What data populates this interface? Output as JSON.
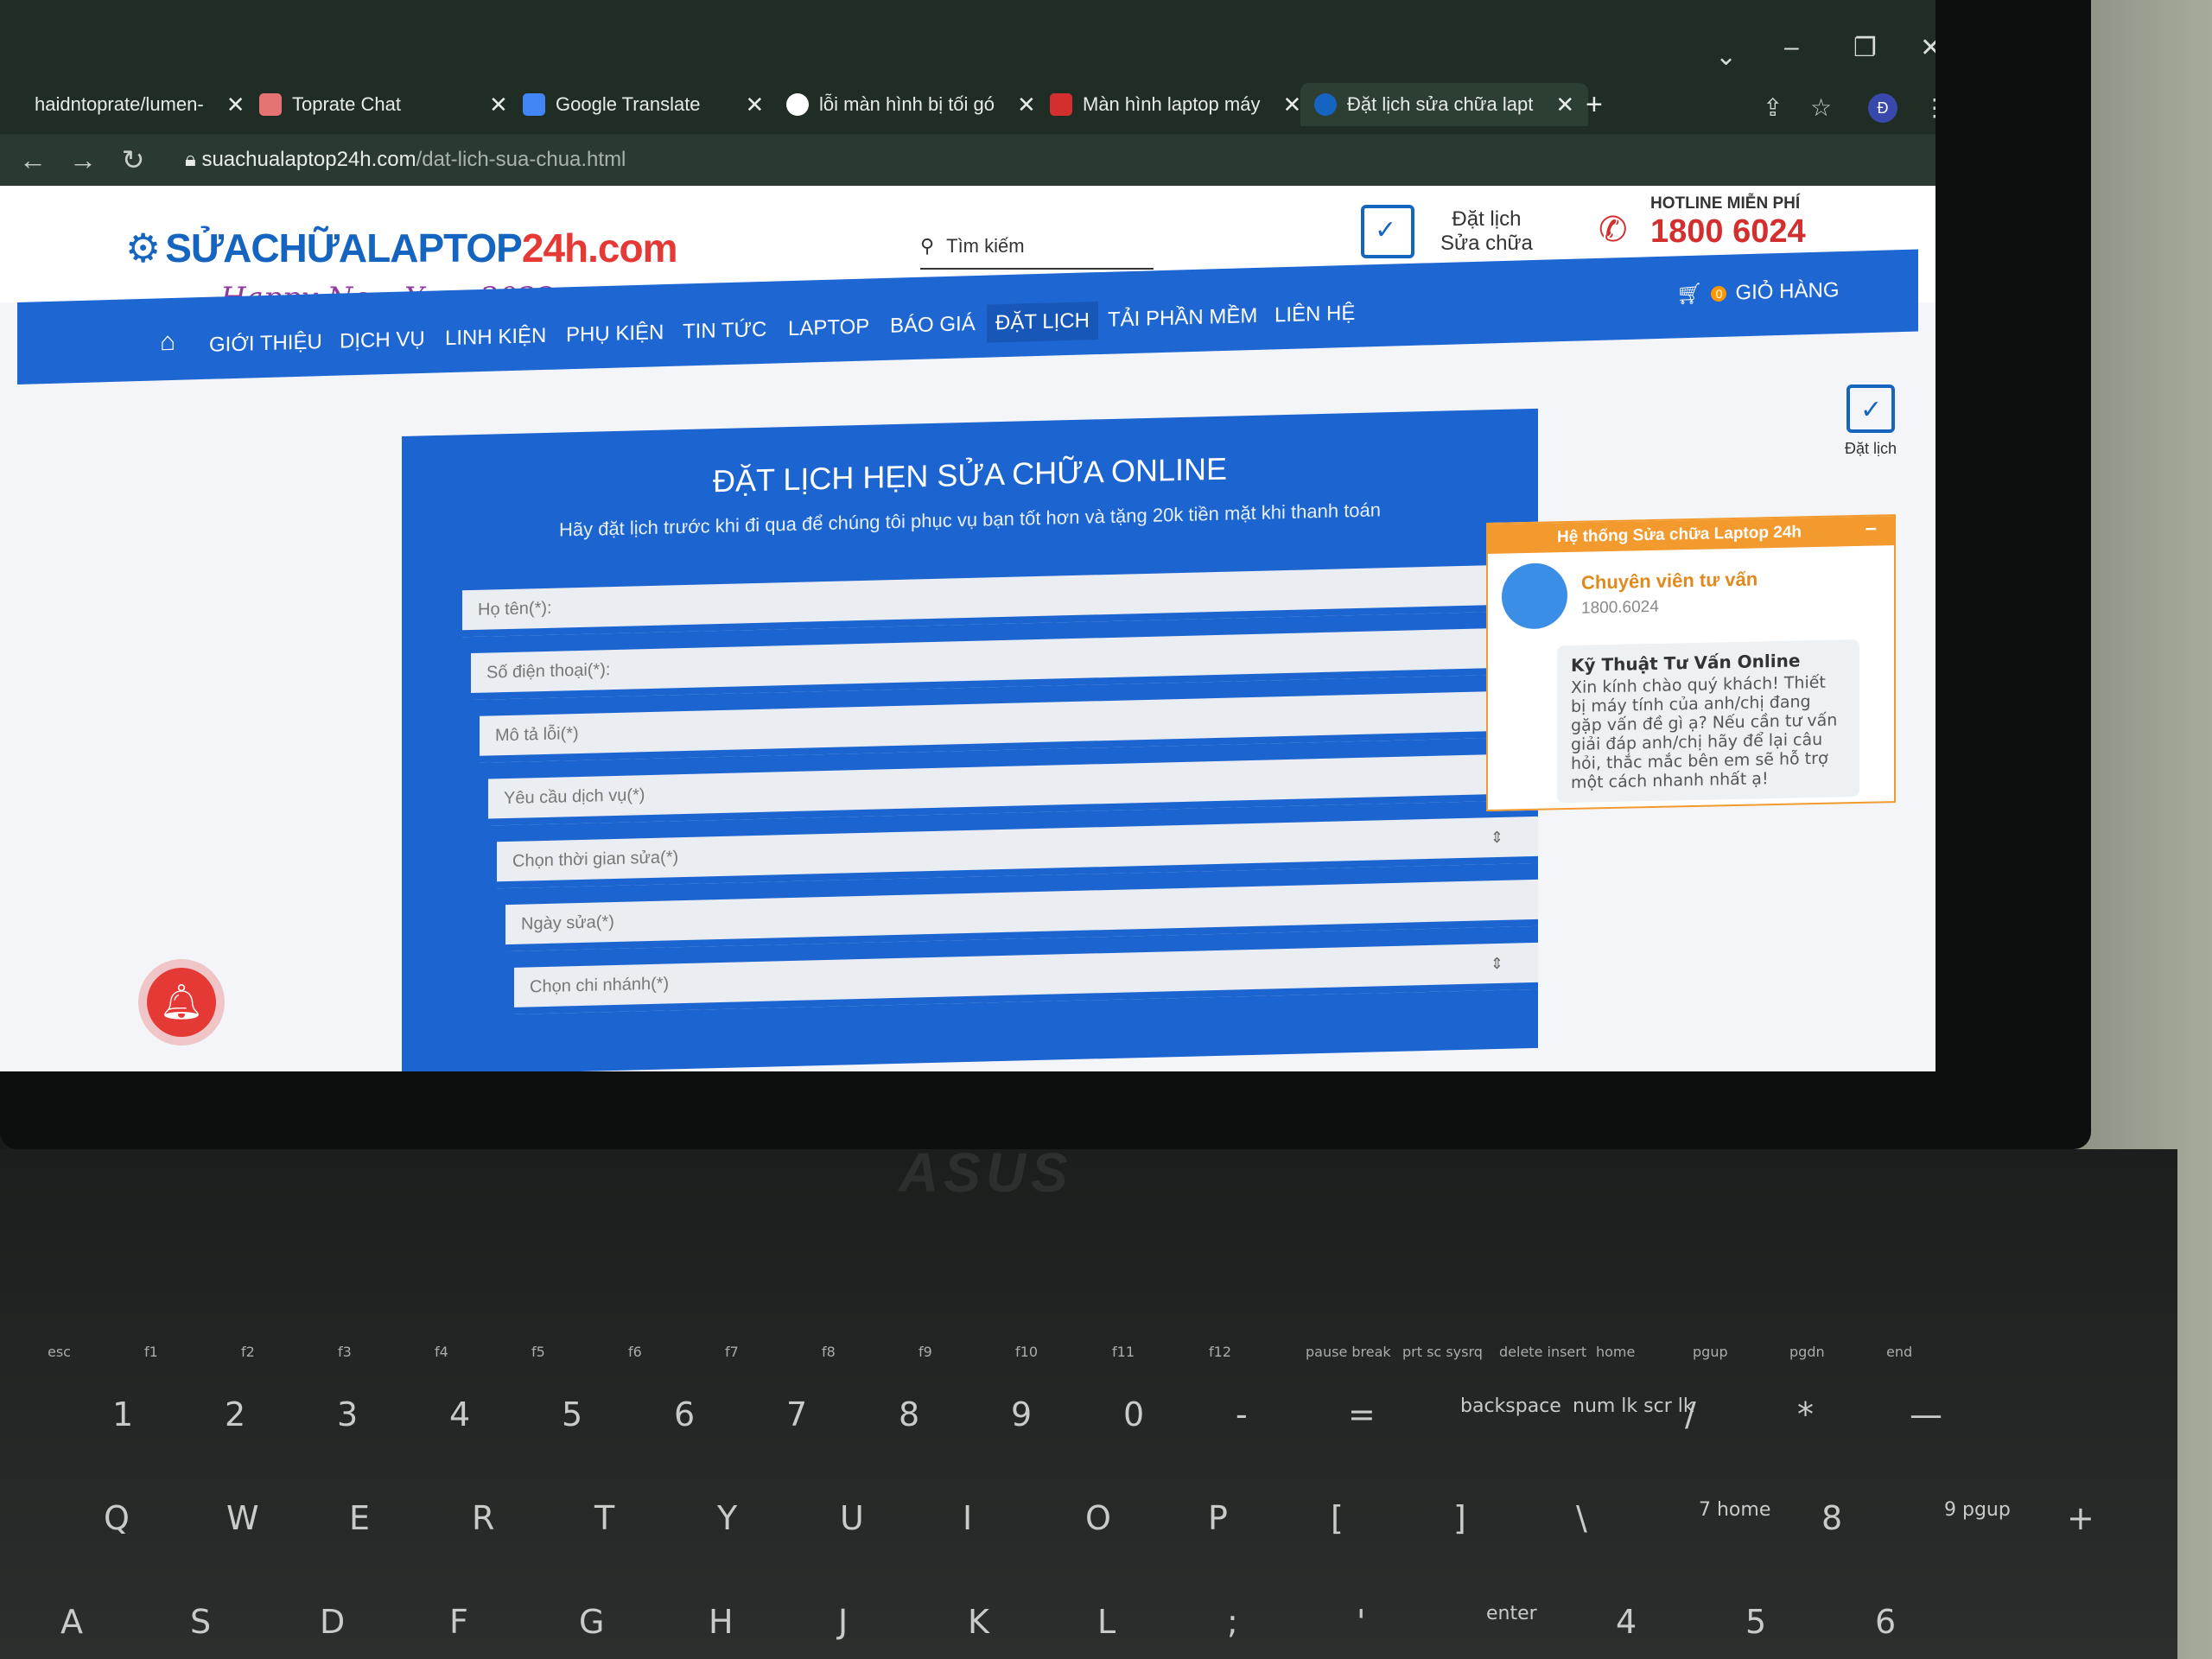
{
  "browser": {
    "tabs": [
      {
        "label": "haidntoprate/lumen-",
        "active": false
      },
      {
        "label": "Toprate Chat",
        "active": false
      },
      {
        "label": "Google Translate",
        "active": false
      },
      {
        "label": "lỗi màn hình bị tối gó",
        "active": false
      },
      {
        "label": "Màn hình laptop máy",
        "active": false
      },
      {
        "label": "Đặt lịch sửa chữa lapt",
        "active": true
      }
    ],
    "new_tab": "+",
    "url_host": "suachualaptop24h.com",
    "url_path": "/dat-lich-sua-chua.html",
    "profile_initial": "Đ"
  },
  "header": {
    "logo_text_main": "SỬACHỮALAPTOP",
    "logo_text_accent": "24h.com",
    "logo_tagline": "Happy New Year 2022",
    "search_placeholder": "Tìm kiếm",
    "booking_line1": "Đặt lịch",
    "booking_line2": "Sửa chữa",
    "hotline_label": "HOTLINE MIỄN PHÍ",
    "hotline_number": "1800 6024"
  },
  "nav": {
    "items": [
      "GIỚI THIỆU",
      "DỊCH VỤ",
      "LINH KIỆN",
      "PHỤ KIỆN",
      "TIN TỨC",
      "LAPTOP",
      "BÁO GIÁ",
      "ĐẶT LỊCH",
      "TẢI PHẦN MỀM",
      "LIÊN HỆ"
    ],
    "active": "ĐẶT LỊCH",
    "cart_label": "GIỎ HÀNG",
    "cart_count": "0"
  },
  "side_booking_label": "Đặt lịch",
  "form": {
    "title": "ĐẶT LỊCH HẸN SỬA CHỮA ONLINE",
    "subtitle": "Hãy đặt lịch trước khi đi qua để chúng tôi phục vụ bạn tốt hơn và tặng 20k tiền mặt khi thanh toán",
    "fields": [
      {
        "placeholder": "Họ tên(*):"
      },
      {
        "placeholder": "Số điện thoại(*):"
      },
      {
        "placeholder": "Mô tả lỗi(*)"
      },
      {
        "placeholder": "Yêu cầu dịch vụ(*)"
      },
      {
        "placeholder": "Chọn thời gian sửa(*)"
      },
      {
        "placeholder": "Ngày sửa(*)"
      },
      {
        "placeholder": "Chọn chi nhánh(*)"
      }
    ]
  },
  "chat": {
    "header": "Hệ thống Sửa chữa Laptop 24h",
    "minimize": "–",
    "agent_name": "Chuyên viên tư vấn",
    "agent_phone": "1800.6024",
    "bubble_title": "Kỹ Thuật Tư Vấn Online",
    "bubble_text": "Xin kính chào quý khách! Thiết bị máy tính của anh/chị đang gặp vấn đề gì ạ? Nếu cần tư vấn giải đáp anh/chị hãy để lại câu hỏi, thắc mắc bên em sẽ hỗ trợ một cách nhanh nhất ạ!"
  },
  "laptop_brand": "ASUS",
  "keyboard": {
    "fn_row": [
      "esc",
      "f1",
      "f2",
      "f3",
      "f4",
      "f5",
      "f6",
      "f7",
      "f8",
      "f9",
      "f10",
      "f11",
      "f12",
      "pause break",
      "prt sc sysrq",
      "delete insert",
      "home",
      "pgup",
      "pgdn",
      "end"
    ],
    "num_row": [
      "1",
      "2",
      "3",
      "4",
      "5",
      "6",
      "7",
      "8",
      "9",
      "0",
      "-",
      "=",
      "backspace",
      "num lk scr lk",
      "/",
      "*",
      "—"
    ],
    "top_row": [
      "Q",
      "W",
      "E",
      "R",
      "T",
      "Y",
      "U",
      "I",
      "O",
      "P",
      "[",
      "]",
      "\\",
      "7 home",
      "8",
      "9 pgup",
      "+"
    ],
    "home_row": [
      "A",
      "S",
      "D",
      "F",
      "G",
      "H",
      "J",
      "K",
      "L",
      ";",
      "'",
      "enter",
      "4",
      "5",
      "6"
    ]
  }
}
